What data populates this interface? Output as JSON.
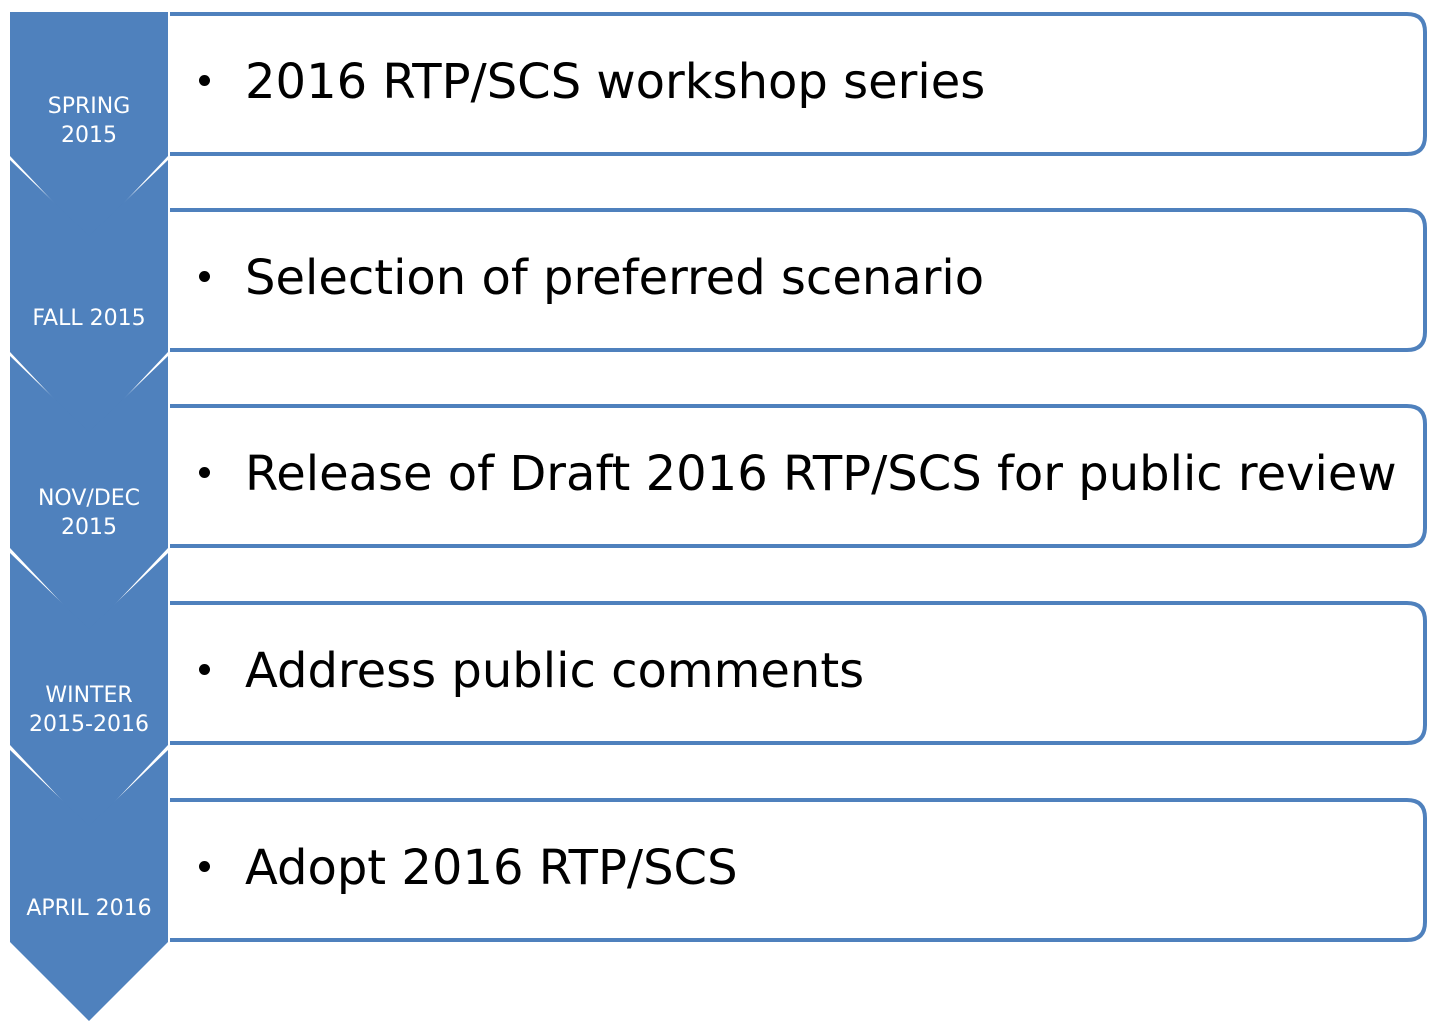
{
  "colors": {
    "chevron_fill": "#4F81BD",
    "box_stroke": "#4F81BD",
    "box_fill": "#FFFFFF",
    "label_text": "#FFFFFF",
    "body_text": "#000000"
  },
  "stages": [
    {
      "period": "SPRING\n2015",
      "description": "2016 RTP/SCS workshop series"
    },
    {
      "period": "FALL 2015",
      "description": "Selection of preferred scenario"
    },
    {
      "period": "NOV/DEC\n2015",
      "description": "Release of Draft 2016 RTP/SCS for public review"
    },
    {
      "period": "WINTER\n2015-2016",
      "description": "Address public comments"
    },
    {
      "period": "APRIL 2016",
      "description": "Adopt 2016 RTP/SCS"
    }
  ]
}
